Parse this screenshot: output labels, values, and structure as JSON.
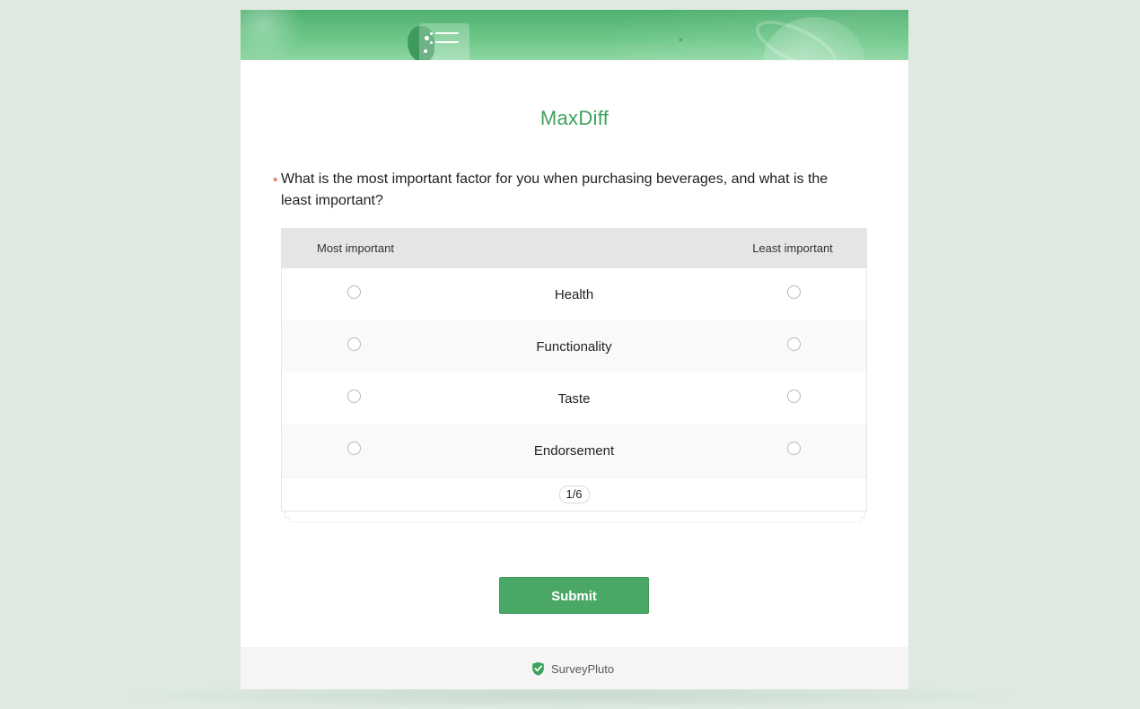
{
  "survey": {
    "title": "MaxDiff"
  },
  "question": {
    "required_mark": "*",
    "text": "What is the most important factor for you when purchasing beverages, and what is the least important?"
  },
  "table": {
    "header_left": "Most important",
    "header_right": "Least important",
    "items": [
      {
        "label": "Health"
      },
      {
        "label": "Functionality"
      },
      {
        "label": "Taste"
      },
      {
        "label": "Endorsement"
      }
    ],
    "pager": "1/6"
  },
  "actions": {
    "submit_label": "Submit"
  },
  "footer": {
    "brand_name": "SurveyPluto",
    "brand_icon": "check-shield-icon"
  },
  "colors": {
    "accent": "#4aa866",
    "title": "#3ea25e",
    "required": "#e53935",
    "background": "#dde9e1"
  }
}
